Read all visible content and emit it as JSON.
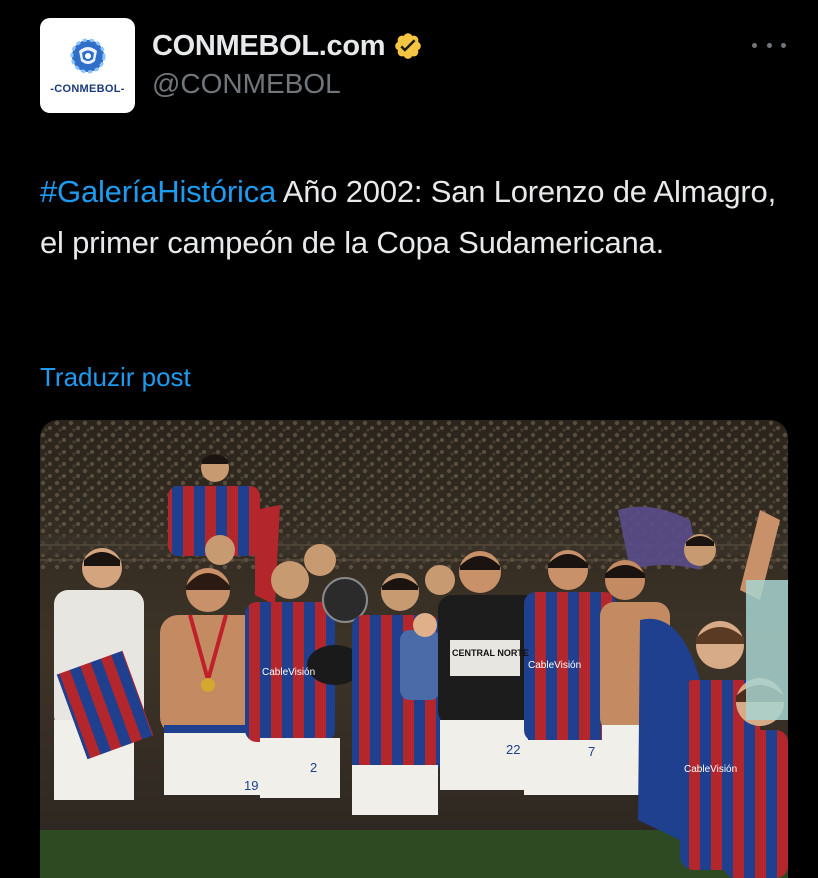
{
  "account": {
    "display_name": "CONMEBOL.com",
    "handle": "@CONMEBOL",
    "avatar_logo_text": "-CONMEBOL-",
    "verified": true,
    "verified_color": "#f4c542"
  },
  "tweet": {
    "hashtag": "#GaleríaHistórica",
    "text": " Año 2002: San Lorenzo de Almagro, el primer campeón de la Copa Sudamericana.",
    "translate_label": "Traduzir post"
  },
  "media": {
    "shirt_sponsor": "CableVisión",
    "banner_text": "CENTRAL NORTE",
    "shorts_numbers": [
      "19",
      "2",
      "22",
      "7"
    ]
  },
  "colors": {
    "background": "#000000",
    "text": "#e7e9ea",
    "secondary": "#71767b",
    "link": "#1d9bf0",
    "san_lorenzo_blue": "#1f3f8f",
    "san_lorenzo_red": "#b3262c"
  }
}
